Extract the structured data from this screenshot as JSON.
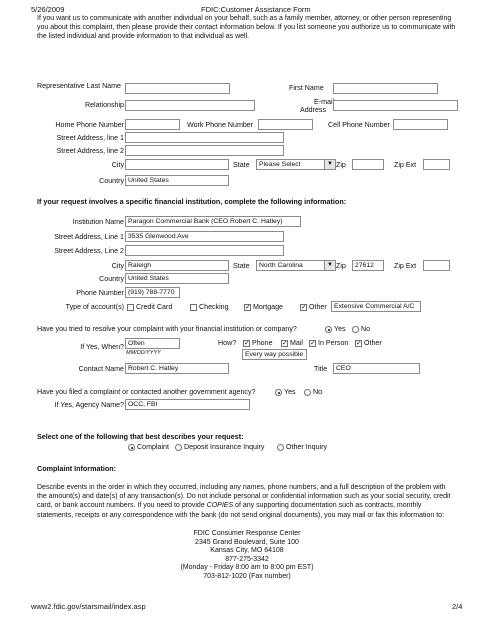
{
  "print": {
    "date": "5/26/2009",
    "title": "FDIC:Customer Assistance Form",
    "url": "www2.fdic.gov/starsmail/index.asp",
    "page": "2/4"
  },
  "rep_intro": "If you want us to communicate with another individual on your behalf, such as a family member, attorney, or other person representing you about this complaint, then please provide their contact information below. If you list someone you authorize us to communicate with the listed individual and provide information to that individual as well.",
  "rep": {
    "last_name_label": "Representative Last Name",
    "first_name_label": "First Name",
    "relationship_label": "Relationship",
    "email_label_1": "E-mail",
    "email_label_2": "Address",
    "home_phone_label": "Home Phone Number",
    "work_phone_label": "Work Phone Number",
    "cell_phone_label": "Cell Phone Number",
    "street1_label": "Street Address, line 1",
    "street2_label": "Street Address, line 2",
    "city_label": "City",
    "state_label": "State",
    "state_value": "Please Select",
    "zip_label": "Zip",
    "zipext_label": "Zip Ext",
    "country_label": "Country",
    "country_value": "United States"
  },
  "fi_heading": "If your request involves a specific financial institution, complete the following information:",
  "fi": {
    "name_label": "Institution Name",
    "name_value": "Paragon Commercial Bank (CEO Robert C. Hatley)",
    "street1_label": "Street Address, Line 1",
    "street1_value": "3535 Glenwood Ave",
    "street2_label": "Street Address, Line 2",
    "city_label": "City",
    "city_value": "Raleigh",
    "state_label": "State",
    "state_value": "North Carolina",
    "zip_label": "Zip",
    "zip_value": "27612",
    "zipext_label": "Zip Ext",
    "country_label": "Country",
    "country_value": "United States",
    "phone_label": "Phone Number",
    "phone_value": "(919) 788-7770",
    "account_label": "Type of account(s)",
    "acct_credit": "Credit Card",
    "acct_checking": "Checking",
    "acct_mortgage": "Mortgage",
    "acct_other": "Other",
    "acct_other_value": "Extensive Commercial A/C"
  },
  "resolve": {
    "question": "Have you tried to resolve your complaint with your financial institution or company?",
    "yes": "Yes",
    "no": "No",
    "when_label": "If Yes, When?",
    "when_value": "Often",
    "when_hint": "MM/DD/YYYY",
    "how_label": "How?",
    "how_phone": "Phone",
    "how_mail": "Mail",
    "how_person": "In Person",
    "how_other": "Other",
    "how_other_value": "Every way possible",
    "contact_label": "Contact Name",
    "contact_value": "Robert C. Hatley",
    "title_label": "Title",
    "title_value": "CEO"
  },
  "agency": {
    "question": "Have you filed a complaint or contacted another government agency?",
    "yes": "Yes",
    "no": "No",
    "name_label": "If Yes, Agency Name?",
    "name_value": "OCC, FBI"
  },
  "request": {
    "heading": "Select one of the following that best describes your request:",
    "opt_complaint": "Complaint",
    "opt_deposit": "Deposit Insurance Inquiry",
    "opt_other": "Other Inquiry"
  },
  "complaint": {
    "heading": "Complaint Information:",
    "text_1": "Describe events in the order in which they occurred, including any names, phone numbers, and a full description of the problem with the amount(s) and date(s) of any transaction(s). Do not include personal or confidential information such as your social security, credit card, or bank account numbers. If you need to provide ",
    "text_copies": "COPIES",
    "text_2": " of any supporting documentation such as contracts, monthly statements, receipts or any correspondence with the bank (do not send original documents), you may mail or fax this information to:",
    "address": [
      "FDIC Consumer Response Center",
      "2345 Grand Boulevard, Suite 100",
      "Kansas City, MO 64108",
      "877-275-3342",
      "(Monday - Friday 8:00 am to 8:00 pm EST)",
      "703-812-1020 (Fax number)"
    ]
  }
}
